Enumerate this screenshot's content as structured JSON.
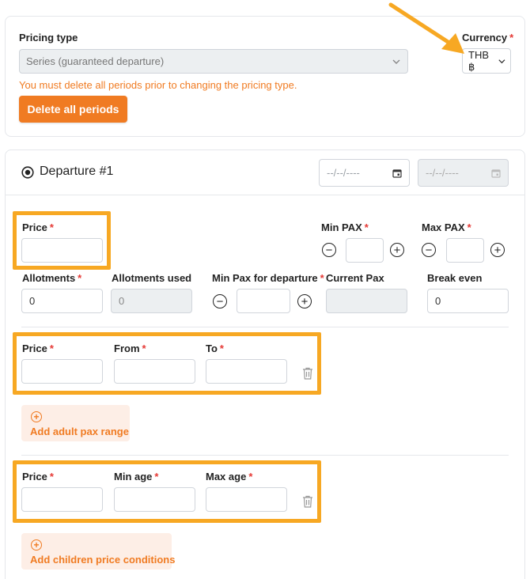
{
  "pricing": {
    "pricing_type_label": "Pricing type",
    "pricing_type_value": "Series (guaranteed departure)",
    "currency_label": "Currency",
    "currency_value": "THB ฿",
    "warning": "You must delete all periods prior to changing the pricing type.",
    "delete_button": "Delete all periods"
  },
  "departure": {
    "title": "Departure #1",
    "date_placeholder": "--/--/----",
    "price_label": "Price",
    "min_pax_label": "Min PAX",
    "max_pax_label": "Max PAX",
    "allotments_label": "Allotments",
    "allotments_value": "0",
    "allotments_used_label": "Allotments used",
    "allotments_used_value": "0",
    "min_pax_departure_label": "Min Pax for departure",
    "current_pax_label": "Current Pax",
    "break_even_label": "Break even",
    "break_even_value": "0"
  },
  "adult_range": {
    "price_label": "Price",
    "from_label": "From",
    "to_label": "To",
    "add_button": "Add adult pax range"
  },
  "children": {
    "price_label": "Price",
    "min_age_label": "Min age",
    "max_age_label": "Max age",
    "add_button": "Add children price conditions"
  },
  "icons": {
    "chevron": "chevron-down-icon",
    "calendar": "calendar-icon",
    "trash": "trash-icon",
    "minus": "minus-circle-icon",
    "plus": "plus-circle-icon"
  },
  "colors": {
    "accent": "#f07b22",
    "highlight": "#f7a823",
    "required": "#e53935"
  }
}
